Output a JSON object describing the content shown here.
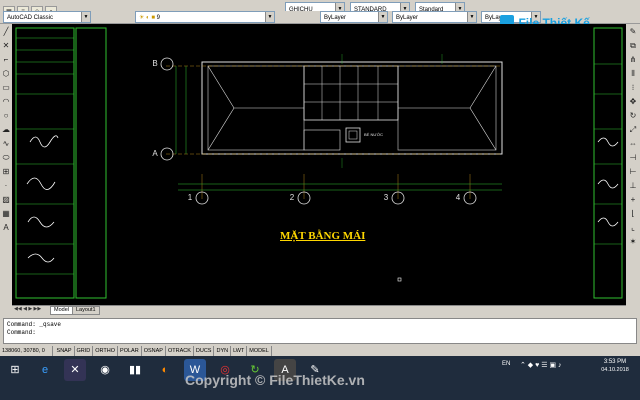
{
  "toolbar": {
    "workspace": "AutoCAD Classic",
    "layer": "9",
    "text_style": "GHICHU",
    "dim_style": "STANDARD",
    "table_style": "Standard",
    "color": "ByLayer",
    "linetype": "ByLayer",
    "lineweight": "ByLayer"
  },
  "drawing": {
    "title": "MẶT BẰNG MÁI",
    "grid_rows": [
      "B",
      "A"
    ],
    "grid_cols": [
      "1",
      "2",
      "3",
      "4"
    ],
    "annotation": "BỂ NƯỚC",
    "colors": {
      "lines": "#e0e0e0",
      "hatch": "#b0b0b0",
      "dims": "#33cc33",
      "annot": "#33cc33",
      "title": "#ffd700",
      "axis": "#d9a520"
    }
  },
  "tabs": [
    "Model",
    "Layout1"
  ],
  "command": {
    "line1": "Command: _qsave",
    "line2": "Command:"
  },
  "status": {
    "coords": "138060, 30780, 0",
    "toggles": [
      "SNAP",
      "GRID",
      "ORTHO",
      "POLAR",
      "OSNAP",
      "OTRACK",
      "DUCS",
      "DYN",
      "LWT",
      "MODEL"
    ]
  },
  "taskbar": {
    "lang": "EN",
    "time": "3:53 PM",
    "date": "04.10.2018"
  },
  "watermark": {
    "logo": "File Thiết Kế .vn",
    "copyright": "Copyright © FileThietKe.vn"
  }
}
